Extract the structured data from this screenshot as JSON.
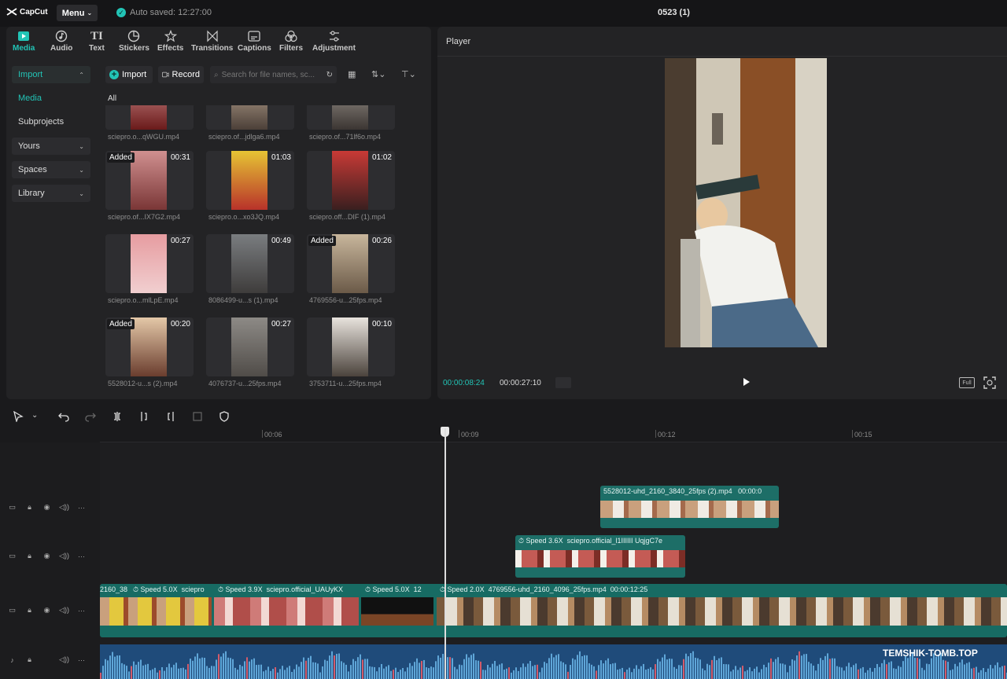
{
  "app": {
    "logo": "CapCut",
    "menu": "Menu",
    "autosave": "Auto saved: 12:27:00",
    "project_title": "0523 (1)"
  },
  "tools": [
    {
      "label": "Media",
      "icon": "media-icon",
      "active": true
    },
    {
      "label": "Audio",
      "icon": "audio-icon"
    },
    {
      "label": "Text",
      "icon": "text-icon"
    },
    {
      "label": "Stickers",
      "icon": "stickers-icon"
    },
    {
      "label": "Effects",
      "icon": "effects-icon"
    },
    {
      "label": "Transitions",
      "icon": "transitions-icon"
    },
    {
      "label": "Captions",
      "icon": "captions-icon"
    },
    {
      "label": "Filters",
      "icon": "filters-icon"
    },
    {
      "label": "Adjustment",
      "icon": "adjustment-icon"
    }
  ],
  "leftnav": {
    "import": "Import",
    "media": "Media",
    "subprojects": "Subprojects",
    "yours": "Yours",
    "spaces": "Spaces",
    "library": "Library"
  },
  "media_toolbar": {
    "import": "Import",
    "record": "Record",
    "search_placeholder": "Search for file names, sc...",
    "all": "All"
  },
  "media_items": [
    {
      "name": "sciepro.o...qWGU.mp4",
      "duration": "",
      "added": ""
    },
    {
      "name": "sciepro.of...jdlga6.mp4",
      "duration": "",
      "added": ""
    },
    {
      "name": "sciepro.of...71lf6o.mp4",
      "duration": "",
      "added": ""
    },
    {
      "name": "sciepro.of...IX7G2.mp4",
      "duration": "00:31",
      "added": "Added"
    },
    {
      "name": "sciepro.o...xo3JQ.mp4",
      "duration": "01:03",
      "added": ""
    },
    {
      "name": "sciepro.off...DIF (1).mp4",
      "duration": "01:02",
      "added": ""
    },
    {
      "name": "sciepro.o...mlLpE.mp4",
      "duration": "00:27",
      "added": ""
    },
    {
      "name": "8086499-u...s (1).mp4",
      "duration": "00:49",
      "added": ""
    },
    {
      "name": "4769556-u...25fps.mp4",
      "duration": "00:26",
      "added": "Added"
    },
    {
      "name": "5528012-u...s (2).mp4",
      "duration": "00:20",
      "added": "Added"
    },
    {
      "name": "4076737-u...25fps.mp4",
      "duration": "00:27",
      "added": ""
    },
    {
      "name": "3753711-u...25fps.mp4",
      "duration": "00:10",
      "added": ""
    }
  ],
  "player": {
    "title": "Player",
    "current": "00:00:08:24",
    "total": "00:00:27:10",
    "full_label": "Full"
  },
  "ruler": [
    "00:06",
    "00:09",
    "00:12",
    "00:15"
  ],
  "clips": {
    "track1": {
      "label": "5528012-uhd_2160_3840_25fps (2).mp4",
      "time": "00:00:0"
    },
    "track2": {
      "speed": "Speed 3.6X",
      "name": "sciepro.official_l1IIIIII UqjgC7e"
    },
    "track3": [
      {
        "text": "2160_38"
      },
      {
        "speed": "Speed 5.0X",
        "name": "sciepro"
      },
      {
        "speed": "Speed 3.9X",
        "name": "sciepro.official_UAUyKX"
      },
      {
        "speed": "Speed 5.0X",
        "name": "12"
      },
      {
        "speed": "Speed 2.0X",
        "name": "4769556-uhd_2160_4096_25fps.mp4",
        "time": "00:00:12:25"
      }
    ]
  },
  "watermark": "TEMSHIK-TOMB.TOP",
  "colors": {
    "accent": "#22c4b6",
    "clip": "#1d6e67",
    "audio": "#1f4b7a"
  }
}
